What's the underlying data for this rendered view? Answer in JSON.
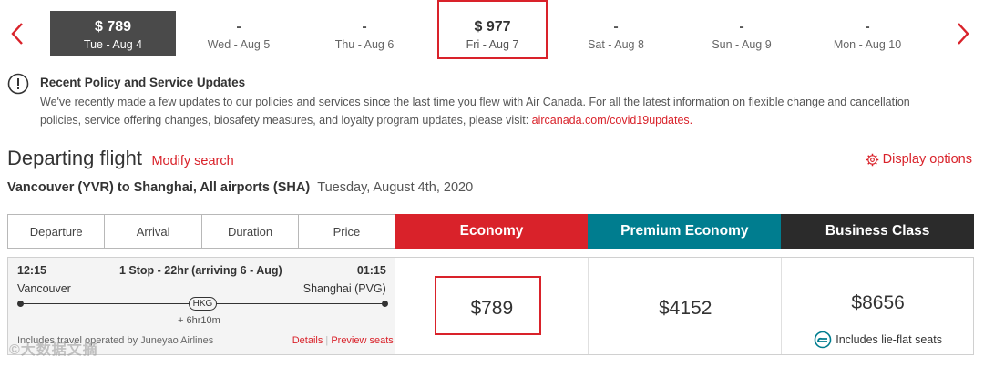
{
  "date_strip": {
    "prev_icon": "chevron-left-icon",
    "next_icon": "chevron-right-icon",
    "dates": [
      {
        "price": "$ 789",
        "day": "Tue - Aug 4"
      },
      {
        "price": "-",
        "day": "Wed - Aug 5"
      },
      {
        "price": "-",
        "day": "Thu - Aug 6"
      },
      {
        "price": "$ 977",
        "day": "Fri - Aug 7"
      },
      {
        "price": "-",
        "day": "Sat - Aug 8"
      },
      {
        "price": "-",
        "day": "Sun - Aug 9"
      },
      {
        "price": "-",
        "day": "Mon - Aug 10"
      }
    ]
  },
  "notice": {
    "icon": "exclamation-circle-icon",
    "title": "Recent Policy and Service Updates",
    "body": "We've recently made a few updates to our policies and services since the last time you flew with Air Canada. For all the latest information on flexible change and cancellation policies, service offering changes, biosafety measures, and loyalty program updates, please visit:",
    "link": "aircanada.com/covid19updates."
  },
  "heading": {
    "title": "Departing flight",
    "modify": "Modify search",
    "display_options": "Display options",
    "route": "Vancouver (YVR) to Shanghai, All airports (SHA)",
    "date": "Tuesday, August 4th, 2020"
  },
  "table": {
    "sort_columns": [
      "Departure",
      "Arrival",
      "Duration",
      "Price"
    ],
    "cabins": [
      "Economy",
      "Premium Economy",
      "Business Class"
    ]
  },
  "flight": {
    "dep_time": "12:15",
    "stops": "1 Stop - 22hr (arriving 6 - Aug)",
    "arr_time": "01:15",
    "origin": "Vancouver",
    "destination": "Shanghai (PVG)",
    "stop_code": "HKG",
    "layover": "+ 6hr10m",
    "operated_by": "Includes travel operated by Juneyao Airlines",
    "details": "Details",
    "separator": "|",
    "preview": "Preview seats",
    "fares": {
      "economy": "$789",
      "premium": "$4152",
      "business": "$8656"
    },
    "lie_flat": "Includes lie-flat seats"
  },
  "watermark": "©大数据文摘",
  "colors": {
    "accent": "#d9222a",
    "economy": "#d9222a",
    "premium": "#007d8f",
    "business": "#2b2b2b",
    "selected_date": "#4a4a4a"
  }
}
